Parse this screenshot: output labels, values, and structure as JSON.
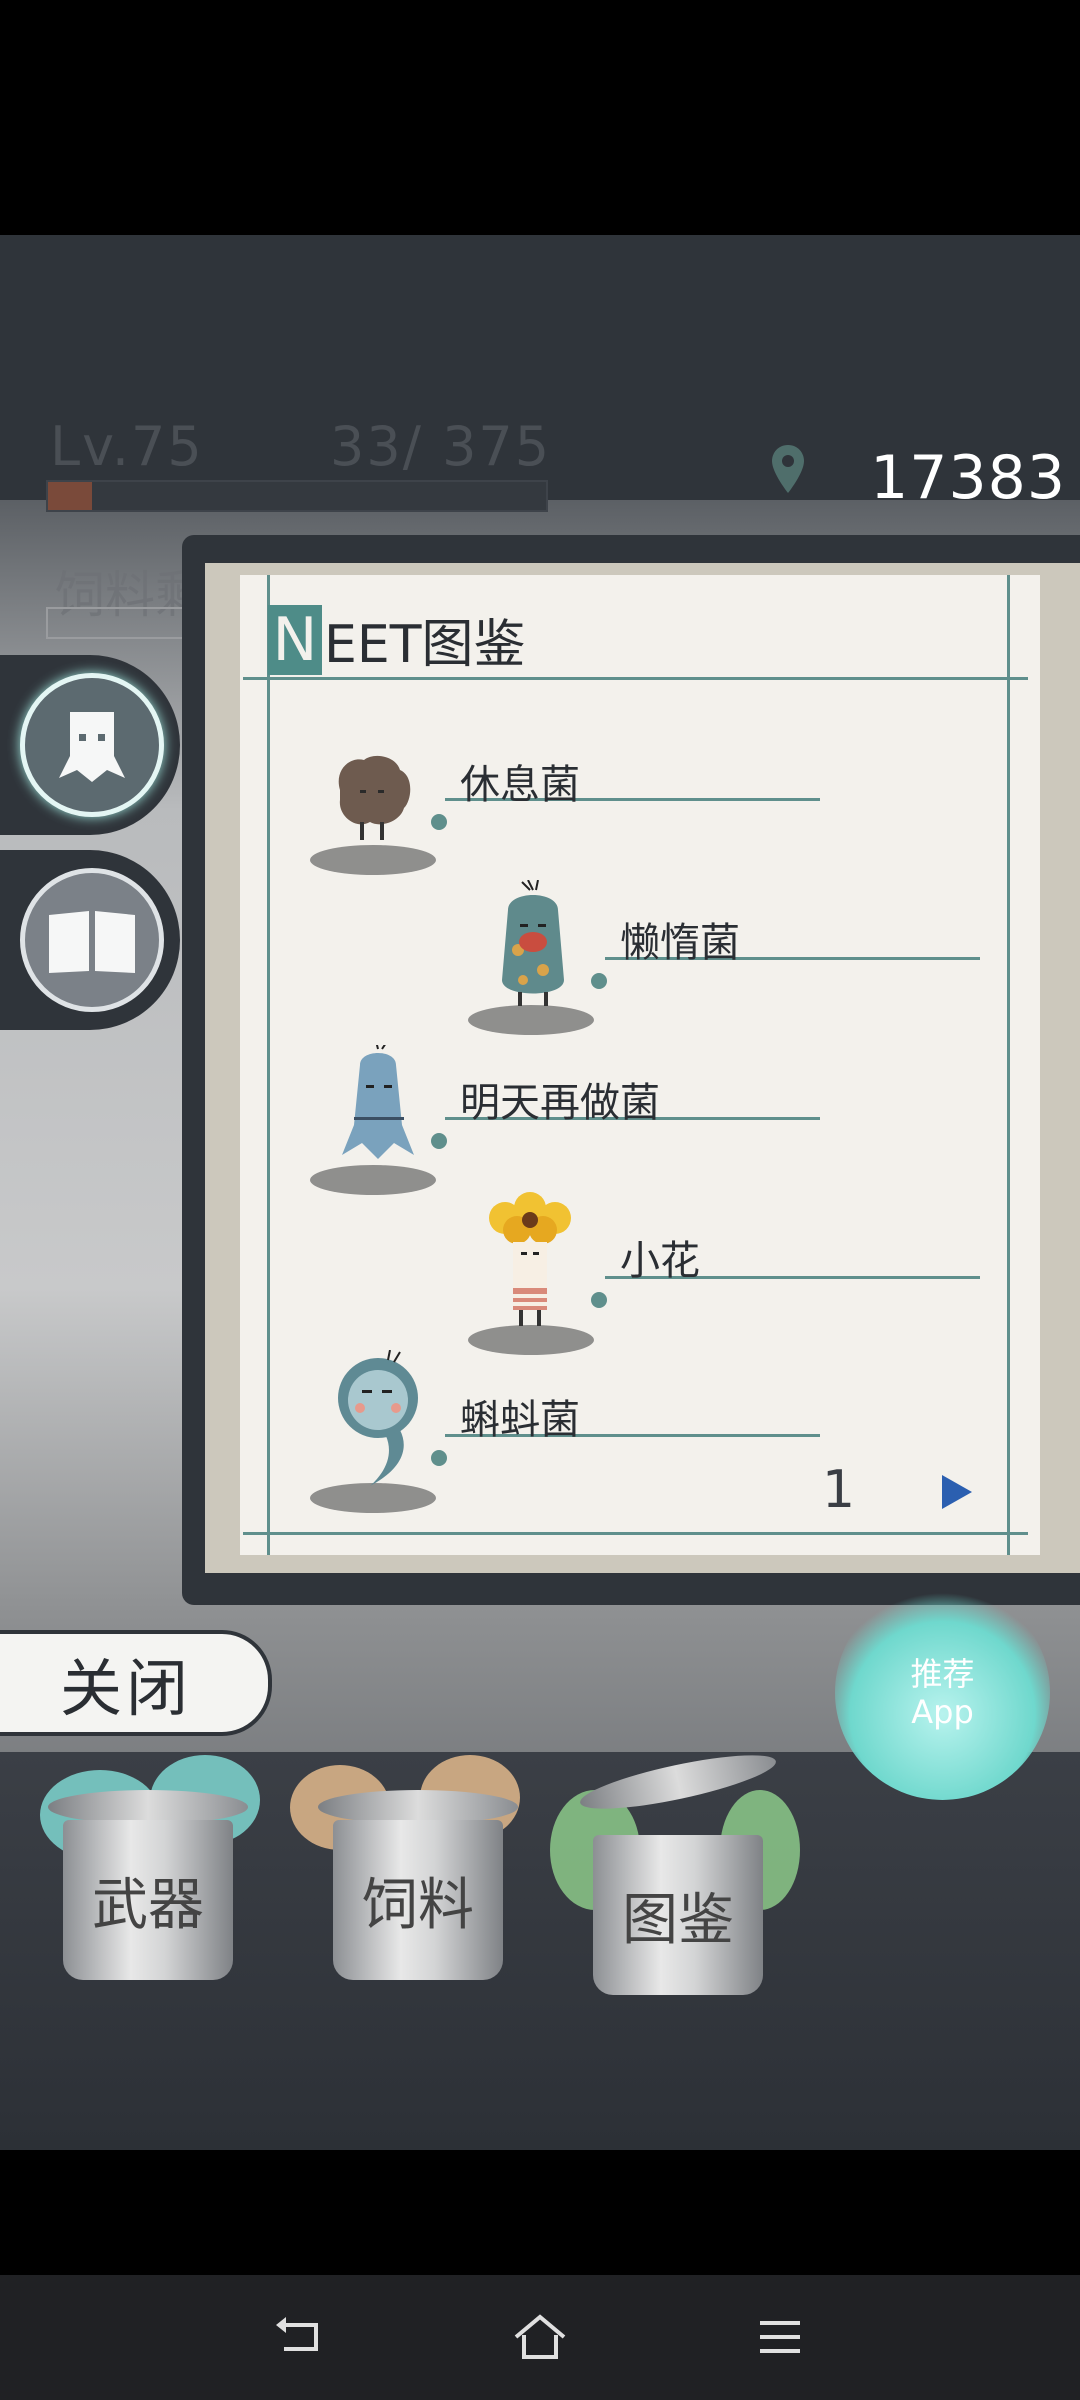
{
  "hud": {
    "level": "Lv.75",
    "exp": "33/  375",
    "exp_fraction": 0.088,
    "feed_label": "饲料剩",
    "coins": "17383"
  },
  "book": {
    "title_initial": "N",
    "title_rest": "EET图鉴",
    "entries": [
      {
        "name": "休息菌",
        "icon": "rest-fungus"
      },
      {
        "name": "懒惰菌",
        "icon": "lazy-fungus"
      },
      {
        "name": "明天再做菌",
        "icon": "tomorrow-fungus"
      },
      {
        "name": "小花",
        "icon": "little-flower"
      },
      {
        "name": "蝌蚪菌",
        "icon": "tadpole-fungus"
      }
    ],
    "page": "1",
    "next_icon": "triangle-right-icon"
  },
  "side_buttons": [
    {
      "icon": "creature-icon",
      "active": true
    },
    {
      "icon": "book-icon",
      "active": false
    }
  ],
  "close_label": "关闭",
  "bins": [
    {
      "label": "武器",
      "plant_color": "#7fd6d0"
    },
    {
      "label": "饲料",
      "plant_color": "#e2b88c"
    },
    {
      "label": "图鉴",
      "plant_color": "#8cc98a"
    }
  ],
  "recommend": {
    "line1": "推荐",
    "line2": "App"
  },
  "colors": {
    "teal": "#5f8f8c",
    "paper": "#f3f1ec",
    "dark": "#2f343a"
  },
  "nav": {
    "back_icon": "back-icon",
    "home_icon": "home-icon",
    "menu_icon": "menu-icon"
  }
}
